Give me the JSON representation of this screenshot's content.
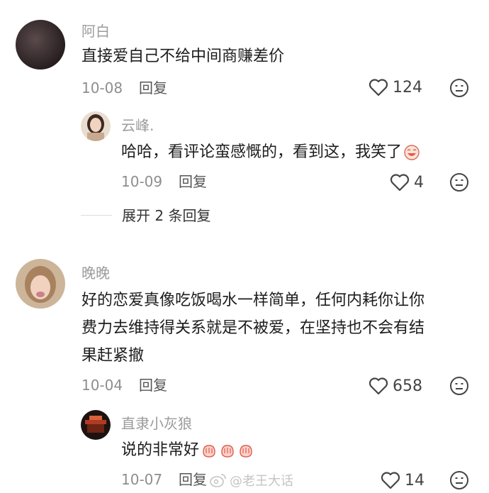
{
  "comments": [
    {
      "username": "阿白",
      "text": "直接爱自己不给中间商赚差价",
      "date": "10-08",
      "reply_label": "回复",
      "likes": "124",
      "replies": [
        {
          "username": "云峰.",
          "text": "哈哈，看评论蛮感慨的，看到这，我笑了",
          "date": "10-09",
          "reply_label": "回复",
          "likes": "4"
        }
      ],
      "expand_label": "展开 2 条回复"
    },
    {
      "username": "晚晚",
      "text_lines": [
        "好的恋爱真像吃饭喝水一样简单，任何内耗你让你",
        "费力去维持得关系就是不被爱，在坚持也不会有结",
        "果赶紧撤"
      ],
      "date": "10-04",
      "reply_label": "回复",
      "likes": "658",
      "replies": [
        {
          "username": "直隶小灰狼",
          "text": "说的非常好",
          "date": "10-07",
          "reply_label": "回复",
          "likes": "14"
        }
      ]
    }
  ],
  "watermark": "@老王大话",
  "icons": {
    "like": "heart-outline-icon",
    "dislike": "unhappy-face-icon",
    "emoji_laugh": "laughing-face-emoji",
    "emoji_fist": "peach-fist-emoji"
  }
}
